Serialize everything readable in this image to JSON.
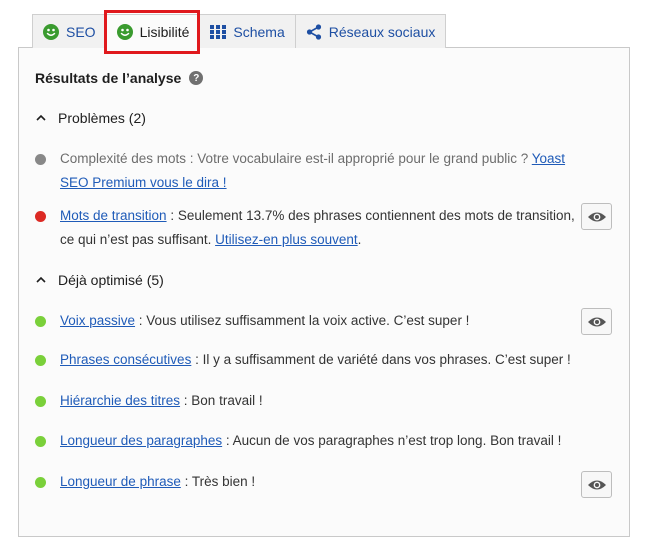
{
  "tabs": [
    {
      "label": "SEO",
      "icon": "smiley-icon"
    },
    {
      "label": "Lisibilité",
      "icon": "smiley-icon"
    },
    {
      "label": "Schema",
      "icon": "grid-icon"
    },
    {
      "label": "Réseaux sociaux",
      "icon": "share-icon"
    }
  ],
  "heading": "Résultats de l’analyse",
  "sections": {
    "problems": {
      "title": "Problèmes (2)",
      "items": [
        {
          "color": "#888888",
          "prefix": "Complexité des mots : Votre vocabulaire est-il approprié pour le grand public ? ",
          "link": "Yoast SEO Premium vous le dira !",
          "suffix": ""
        },
        {
          "color": "#dc2a24",
          "link": "Mots de transition",
          "text": " : Seulement 13.7% des phrases contiennent des mots de transition, ce qui n’est pas suffisant. ",
          "link2": "Utilisez-en plus souvent",
          "end": "."
        }
      ]
    },
    "good": {
      "title": "Déjà optimisé (5)",
      "items": [
        {
          "color": "#7ad03a",
          "link": "Voix passive",
          "text": " : Vous utilisez suffisamment la voix active. C’est super !"
        },
        {
          "color": "#7ad03a",
          "link": "Phrases consécutives",
          "text": " : Il y a suffisamment de variété dans vos phrases. C’est super !"
        },
        {
          "color": "#7ad03a",
          "link": "Hiérarchie des titres",
          "text": " : Bon travail !"
        },
        {
          "color": "#7ad03a",
          "link": "Longueur des paragraphes",
          "text": " : Aucun de vos paragraphes n’est trop long. Bon travail !"
        },
        {
          "color": "#7ad03a",
          "link": "Longueur de phrase",
          "text": " : Très bien !"
        }
      ]
    }
  },
  "colors": {
    "highlight": "#e0191d",
    "link": "#1f5bb8",
    "smiley": "#3a9b2f"
  }
}
